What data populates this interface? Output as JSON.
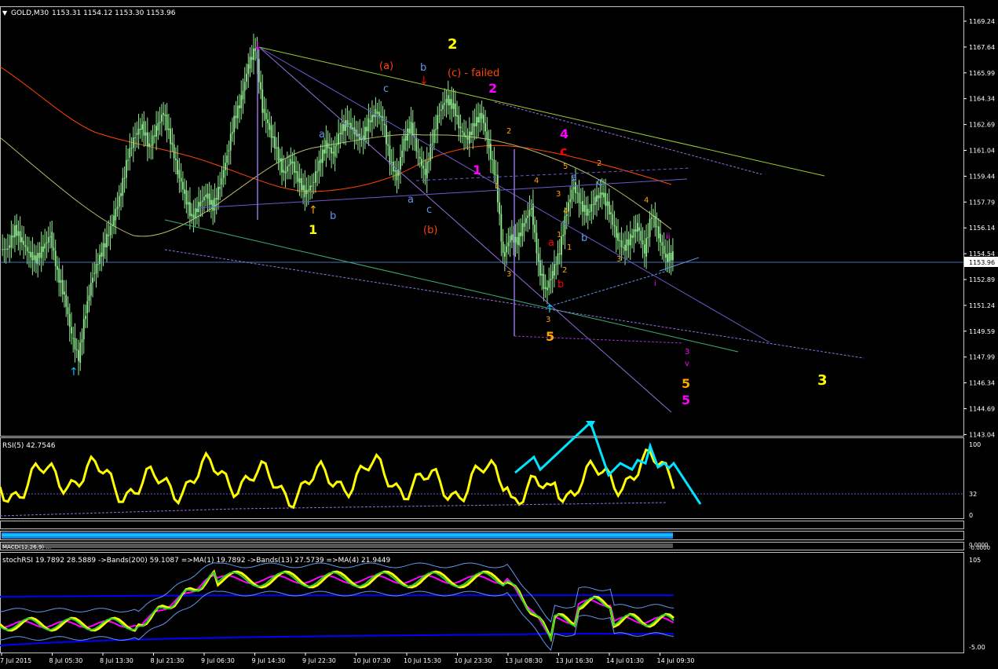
{
  "header": {
    "symbol": "GOLD,M30",
    "ohlc": "1153.31 1154.12 1153.30 1153.96"
  },
  "price_axis": {
    "ticks": [
      "1169.24",
      "1167.64",
      "1165.99",
      "1164.34",
      "1162.69",
      "1161.04",
      "1159.44",
      "1157.79",
      "1156.14",
      "1154.54",
      "1152.89",
      "1151.24",
      "1149.59",
      "1147.99",
      "1146.34",
      "1144.69",
      "1143.04"
    ],
    "current": "1153.96",
    "range": [
      1142.5,
      1170.0
    ]
  },
  "time_axis": [
    "7 Jul 2015",
    "8 Jul 05:30",
    "8 Jul 13:30",
    "8 Jul 21:30",
    "9 Jul 06:30",
    "9 Jul 14:30",
    "9 Jul 22:30",
    "10 Jul 07:30",
    "10 Jul 15:30",
    "10 Jul 23:30",
    "13 Jul 08:30",
    "13 Jul 16:30",
    "14 Jul 01:30",
    "14 Jul 09:30"
  ],
  "rsi": {
    "label": "RSI(5) 42.7546",
    "ticks": [
      "100",
      "32",
      "0"
    ]
  },
  "macd": {
    "label": "MACD(12,26,9) ...",
    "ticks": [
      "0.0000",
      "-0.0000"
    ]
  },
  "stoch": {
    "label": "stochRSI 19.7892 28.5889  ->Bands(200) 59.1087  =>MA(1) 19.7892  ->Bands(13) 27.5739  =>MA(4) 21.9449",
    "ticks": [
      "105",
      "-5.00"
    ]
  },
  "annotations": [
    {
      "text": "2",
      "color": "#ffff00"
    },
    {
      "text": "(a)",
      "color": "#ff4500"
    },
    {
      "text": "b",
      "color": "#6495ed"
    },
    {
      "text": "(c) - failed",
      "color": "#ff4500"
    },
    {
      "text": "2",
      "color": "#ff00ff"
    },
    {
      "text": "c",
      "color": "#6495ed"
    },
    {
      "text": "a",
      "color": "#6495ed"
    },
    {
      "text": "b",
      "color": "#6495ed"
    },
    {
      "text": "1",
      "color": "#ffff00"
    },
    {
      "text": "a",
      "color": "#6495ed"
    },
    {
      "text": "c",
      "color": "#6495ed"
    },
    {
      "text": "(b)",
      "color": "#ff4500"
    },
    {
      "text": "1",
      "color": "#ff00ff"
    },
    {
      "text": "2",
      "color": "#ffa500"
    },
    {
      "text": "1",
      "color": "#ffa500"
    },
    {
      "text": "3",
      "color": "#ffa500"
    },
    {
      "text": "4",
      "color": "#ff00ff"
    },
    {
      "text": "c",
      "color": "#ff0000"
    },
    {
      "text": "5",
      "color": "#ffa500"
    },
    {
      "text": "a",
      "color": "#6495ed"
    },
    {
      "text": "c",
      "color": "#6495ed"
    },
    {
      "text": "2",
      "color": "#ffa500"
    },
    {
      "text": "4",
      "color": "#ffa500"
    },
    {
      "text": "3",
      "color": "#ffa500"
    },
    {
      "text": "1",
      "color": "#ffa500"
    },
    {
      "text": "4",
      "color": "#ffa500"
    },
    {
      "text": "a",
      "color": "#ff0000"
    },
    {
      "text": "1",
      "color": "#ffa500"
    },
    {
      "text": "b",
      "color": "#6495ed"
    },
    {
      "text": "3",
      "color": "#ffa500"
    },
    {
      "text": "4",
      "color": "#ffa500"
    },
    {
      "text": "ii",
      "color": "#ff00ff"
    },
    {
      "text": "2",
      "color": "#ffa500"
    },
    {
      "text": "b",
      "color": "#ff0000"
    },
    {
      "text": "i",
      "color": "#ff00ff"
    },
    {
      "text": "3",
      "color": "#ffa500"
    },
    {
      "text": "5",
      "color": "#ffa500"
    },
    {
      "text": "3",
      "color": "#ff00ff"
    },
    {
      "text": "v",
      "color": "#ff00ff"
    },
    {
      "text": "5",
      "color": "#ffa500"
    },
    {
      "text": "5",
      "color": "#ff00ff"
    },
    {
      "text": "3",
      "color": "#ffff00"
    },
    {
      "text": "5",
      "color": "#ffff00"
    }
  ],
  "colors": {
    "candles": "#90ee90",
    "rsi": "#ffff00",
    "cyan": "#00e5ff",
    "ma_red": "#ff4500",
    "ma_olive": "#bdb76b"
  },
  "chart_data": {
    "type": "candlestick",
    "title": "GOLD,M30",
    "ylim": [
      1142.5,
      1170.0
    ],
    "close_series": [
      1154.5,
      1155.8,
      1155.0,
      1154.2,
      1153.8,
      1154.6,
      1155.4,
      1153.0,
      1151.5,
      1149.0,
      1147.5,
      1150.5,
      1152.8,
      1154.0,
      1155.2,
      1156.5,
      1158.2,
      1160.5,
      1161.8,
      1162.4,
      1161.0,
      1162.2,
      1163.3,
      1161.5,
      1159.5,
      1158.0,
      1156.5,
      1157.3,
      1158.0,
      1157.2,
      1158.6,
      1160.5,
      1162.8,
      1164.1,
      1166.3,
      1167.4,
      1163.5,
      1162.2,
      1160.8,
      1159.3,
      1160.2,
      1159.0,
      1158.1,
      1158.6,
      1160.0,
      1161.2,
      1160.6,
      1162.1,
      1162.6,
      1162.0,
      1161.5,
      1162.6,
      1163.3,
      1162.8,
      1160.2,
      1159.1,
      1161.5,
      1162.4,
      1160.5,
      1159.3,
      1161.5,
      1163.3,
      1164.1,
      1163.6,
      1162.1,
      1161.5,
      1162.6,
      1163.1,
      1161.0,
      1159.0,
      1154.0,
      1155.3,
      1155.0,
      1156.2,
      1157.2,
      1153.5,
      1151.8,
      1153.0,
      1154.4,
      1157.0,
      1158.6,
      1157.3,
      1156.8,
      1157.7,
      1158.1,
      1157.0,
      1155.4,
      1154.5,
      1155.2,
      1156.0,
      1154.3,
      1156.8,
      1155.4,
      1153.9,
      1154.1
    ]
  }
}
